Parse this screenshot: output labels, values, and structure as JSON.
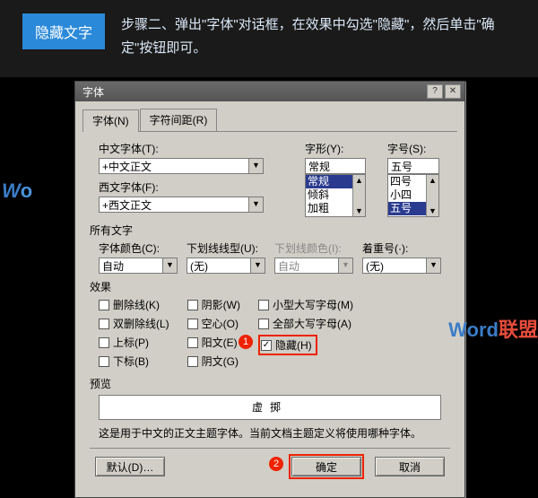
{
  "header": {
    "badge": "隐藏文字",
    "instruction": "步骤二、弹出\"字体\"对话框，在效果中勾选\"隐藏\"，然后单击\"确定\"按钮即可。"
  },
  "dialog": {
    "title": "字体",
    "tabs": {
      "font": "字体(N)",
      "spacing": "字符间距(R)"
    },
    "cn_font": {
      "label": "中文字体(T):",
      "value": "+中文正文"
    },
    "lat_font": {
      "label": "西文字体(F):",
      "value": "+西文正文"
    },
    "style": {
      "label": "字形(Y):",
      "value": "常规",
      "opts": [
        "常规",
        "倾斜",
        "加粗"
      ]
    },
    "size": {
      "label": "字号(S):",
      "value": "五号",
      "opts": [
        "四号",
        "小四",
        "五号"
      ]
    },
    "alltext": "所有文字",
    "color": {
      "label": "字体颜色(C):",
      "value": "自动"
    },
    "ul": {
      "label": "下划线线型(U):",
      "value": "(无)"
    },
    "ulcolor": {
      "label": "下划线颜色(I):",
      "value": "自动"
    },
    "emph": {
      "label": "着重号(·):",
      "value": "(无)"
    },
    "effects_title": "效果",
    "fx": {
      "strike": "删除线(K)",
      "dstrike": "双删除线(L)",
      "super": "上标(P)",
      "sub": "下标(B)",
      "shadow": "阴影(W)",
      "outline": "空心(O)",
      "emboss": "阳文(E)",
      "engrave": "阴文(G)",
      "smallcaps": "小型大写字母(M)",
      "allcaps": "全部大写字母(A)",
      "hidden": "隐藏(H)"
    },
    "preview_title": "预览",
    "preview_text": "虚掷",
    "note": "这是用于中文的正文主题字体。当前文档主题定义将使用哪种字体。",
    "buttons": {
      "default": "默认(D)…",
      "ok": "确定",
      "cancel": "取消"
    },
    "callouts": {
      "one": "1",
      "two": "2"
    }
  },
  "watermark": {
    "left": "Word",
    "right_en": "Word",
    "right_cn": "联盟"
  }
}
